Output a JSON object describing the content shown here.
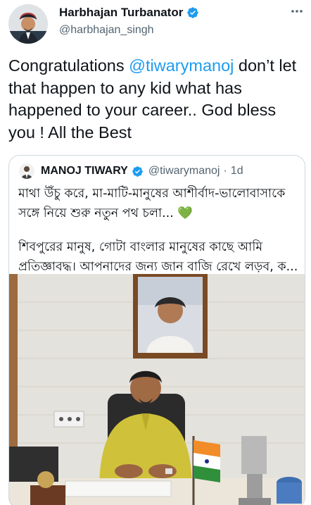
{
  "author": {
    "display_name": "Harbhajan Turbanator",
    "handle": "@harbhajan_singh",
    "avatar_icon": "avatar-photo",
    "verified_icon": "verified-badge-icon"
  },
  "tweet": {
    "text_before": "Congratulations ",
    "mention": "@tiwarymanoj",
    "text_after": " don’t let that happen to any kid what has happened to your career.. God bless you ! All the Best"
  },
  "quoted": {
    "display_name": "MANOJ TIWARY",
    "handle": "@tiwarymanoj",
    "separator": "·",
    "time": "1d",
    "para1": "মাথা উঁচু করে, মা-মাটি-মানুষের আশীর্বাদ-ভালোবাসাকে সঙ্গে নিয়ে শুরু নতুন পথ চলা... ",
    "heart": "💚",
    "para2": "শিবপুরের মানুষ, গোটা বাংলার মানুষের কাছে আমি প্রতিজ্ঞাবদ্ধ। আপনাদের জন্য জান বাজি রেখে লড়ব, ক...",
    "photo_description_icon": "office-photo"
  },
  "colors": {
    "link": "#1d9bf0",
    "verified": "#1d9bf0",
    "secondary_text": "#536471",
    "border": "#cfd9de",
    "heart": "#6dbd2f"
  }
}
